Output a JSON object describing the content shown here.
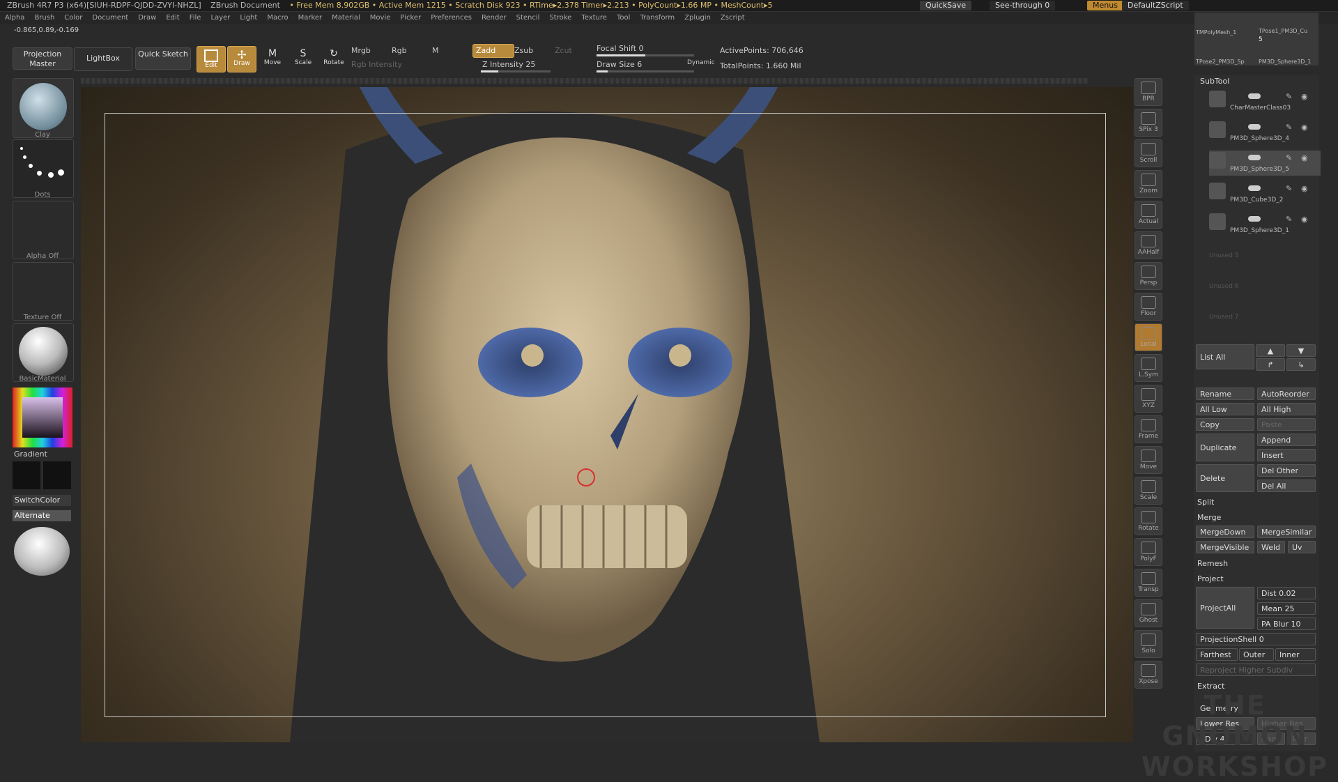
{
  "titlebar": {
    "app": "ZBrush 4R7 P3 (x64)[SIUH-RDPF-QJDD-ZVYI-NHZL]",
    "document": "ZBrush Document",
    "freemem": "• Free Mem 8.902GB • Active Mem 1215 • Scratch Disk 923 • RTime▸2.378 Timer▸2.213 • PolyCount▸1.66 MP • MeshCount▸5",
    "quicksave": "QuickSave",
    "seethrough": "See-through  0",
    "menus": "Menus",
    "defaultzscript": "DefaultZScript"
  },
  "menubar": [
    "Alpha",
    "Brush",
    "Color",
    "Document",
    "Draw",
    "Edit",
    "File",
    "Layer",
    "Light",
    "Macro",
    "Marker",
    "Material",
    "Movie",
    "Picker",
    "Preferences",
    "Render",
    "Stencil",
    "Stroke",
    "Texture",
    "Tool",
    "Transform",
    "Zplugin",
    "Zscript"
  ],
  "coords": "-0.865,0.89,-0.169",
  "toolbar": {
    "projection_master": "Projection Master",
    "lightbox": "LightBox",
    "quick_sketch": "Quick Sketch",
    "edit": "Edit",
    "draw": "Draw",
    "move": "Move",
    "scale": "Scale",
    "rotate": "Rotate",
    "mrgb": "Mrgb",
    "rgb": "Rgb",
    "m": "M",
    "rgb_intensity": "Rgb Intensity",
    "zadd": "Zadd",
    "zsub": "Zsub",
    "zcut": "Zcut",
    "z_intensity": "Z Intensity 25",
    "z_intensity_value": 25,
    "focal_shift": "Focal Shift 0",
    "draw_size": "Draw Size 6",
    "dynamic": "Dynamic",
    "active_points": "ActivePoints: 706,646",
    "total_points": "TotalPoints: 1.660 Mil"
  },
  "left": {
    "clay": "Clay",
    "dots": "Dots",
    "alpha": "Alpha Off",
    "texture": "Texture Off",
    "material": "BasicMaterial",
    "gradient": "Gradient",
    "switchcolor": "SwitchColor",
    "alternate": "Alternate"
  },
  "righttools": [
    {
      "name": "bpr",
      "label": "BPR"
    },
    {
      "name": "spix",
      "label": "SPix 3"
    },
    {
      "name": "scroll",
      "label": "Scroll"
    },
    {
      "name": "zoom",
      "label": "Zoom"
    },
    {
      "name": "actual",
      "label": "Actual"
    },
    {
      "name": "aahalf",
      "label": "AAHalf"
    },
    {
      "name": "persp",
      "label": "Persp"
    },
    {
      "name": "floor",
      "label": "Floor"
    },
    {
      "name": "local",
      "label": "Local"
    },
    {
      "name": "lsym",
      "label": "L.Sym"
    },
    {
      "name": "xyz",
      "label": "XYZ"
    },
    {
      "name": "frame",
      "label": "Frame"
    },
    {
      "name": "move",
      "label": "Move"
    },
    {
      "name": "scale",
      "label": "Scale"
    },
    {
      "name": "rotate",
      "label": "Rotate"
    },
    {
      "name": "polyf",
      "label": "PolyF"
    },
    {
      "name": "transp",
      "label": "Transp"
    },
    {
      "name": "ghost",
      "label": "Ghost"
    },
    {
      "name": "solo",
      "label": "Solo"
    },
    {
      "name": "xpose",
      "label": "Xpose"
    }
  ],
  "tool_thumbs": [
    "TMPolyMesh_1",
    "TPose1_PM3D_Cu",
    "TPose2_PM3D_Sp",
    "PM3D_Sphere3D_1"
  ],
  "tool_count": "5",
  "subtool": {
    "title": "SubTool",
    "items": [
      "CharMasterClass03",
      "PM3D_Sphere3D_4",
      "PM3D_Sphere3D_5",
      "PM3D_Cube3D_2",
      "PM3D_Sphere3D_1"
    ],
    "undefined": [
      "Unused 5",
      "Unused 6",
      "Unused 7"
    ],
    "list_all": "List All",
    "rename": "Rename",
    "autoreorder": "AutoReorder",
    "all_low": "All Low",
    "all_high": "All High",
    "copy": "Copy",
    "paste": "Paste",
    "duplicate": "Duplicate",
    "append": "Append",
    "insert": "Insert",
    "delete": "Delete",
    "del_other": "Del Other",
    "del_all": "Del All",
    "split": "Split",
    "merge": "Merge",
    "mergedown": "MergeDown",
    "mergesimilar": "MergeSimilar",
    "mergevisible": "MergeVisible",
    "weld": "Weld",
    "uv": "Uv",
    "remesh": "Remesh",
    "project": "Project",
    "projectall": "ProjectAll",
    "dist": "Dist 0.02",
    "mean": "Mean 25",
    "pa_blur": "PA Blur 10",
    "projectionshell": "ProjectionShell 0",
    "farthest": "Farthest",
    "outer": "Outer",
    "inner": "Inner",
    "reproject": "Reproject Higher Subdiv",
    "extract": "Extract",
    "geometry": "Geometry",
    "lower_res": "Lower Res",
    "higher_res": "Higher Res",
    "sdiv": "SDiv 4",
    "cage": "Cage",
    "rstr": "Rstr"
  },
  "watermark": "THE GNOMON WORKSHOP"
}
